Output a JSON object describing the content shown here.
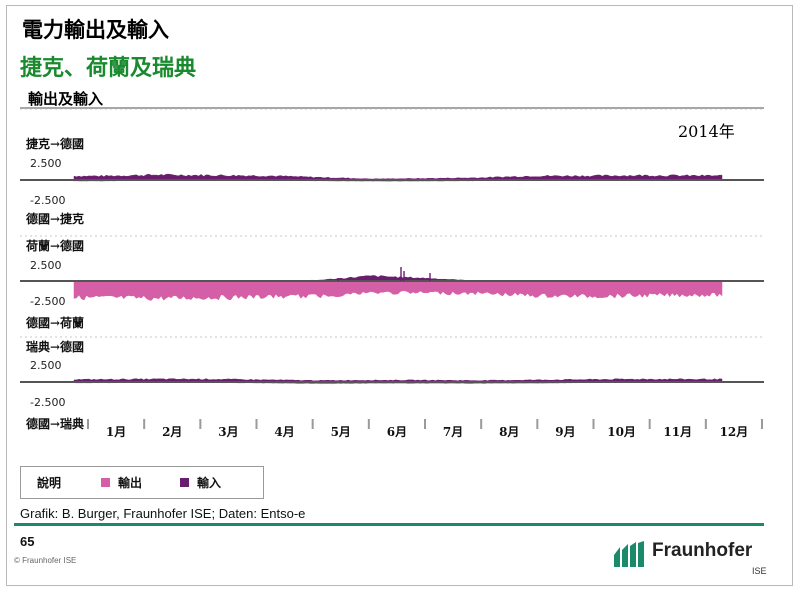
{
  "header": {
    "title": "電力輸出及輸入",
    "subtitle": "捷克、荷蘭及瑞典"
  },
  "chart_heading": "輸出及輸入",
  "year_label": "2014年",
  "colors": {
    "export": "#d45fa6",
    "import": "#6a1d6e",
    "axis": "#555555",
    "subtitle": "#1a8a2e",
    "brand": "#1a8a6a"
  },
  "chart_data": {
    "type": "area",
    "title": "輸出及輸入",
    "x_unit": "2014",
    "months": [
      "1月",
      "2月",
      "3月",
      "4月",
      "5月",
      "6月",
      "7月",
      "8月",
      "9月",
      "10月",
      "11月",
      "12月"
    ],
    "ytick_labels": [
      "2.500",
      "-2.500"
    ],
    "series": [
      {
        "name": "輸出"
      },
      {
        "name": "輸入"
      }
    ],
    "panels": [
      {
        "top_label": "捷克→德國",
        "bottom_label": "德國→捷克",
        "ylim": [
          -2500,
          2500
        ],
        "monthly": [
          {
            "month": "1月",
            "import": 550,
            "export": -150
          },
          {
            "month": "2月",
            "import": 720,
            "export": -40
          },
          {
            "month": "3月",
            "import": 660,
            "export": -40
          },
          {
            "month": "4月",
            "import": 600,
            "export": -60
          },
          {
            "month": "5月",
            "import": 380,
            "export": -120
          },
          {
            "month": "6月",
            "import": 150,
            "export": -180
          },
          {
            "month": "7月",
            "import": 210,
            "export": -150
          },
          {
            "month": "8月",
            "import": 310,
            "export": -120
          },
          {
            "month": "9月",
            "import": 560,
            "export": -50
          },
          {
            "month": "10月",
            "import": 580,
            "export": -40
          },
          {
            "month": "11月",
            "import": 640,
            "export": -40
          },
          {
            "month": "12月",
            "import": 600,
            "export": -40
          }
        ]
      },
      {
        "top_label": "荷蘭→德國",
        "bottom_label": "德國→荷蘭",
        "ylim": [
          -2500,
          2500
        ],
        "monthly": [
          {
            "month": "1月",
            "import": 0,
            "export": -2400
          },
          {
            "month": "2月",
            "import": 0,
            "export": -2500
          },
          {
            "month": "3月",
            "import": 0,
            "export": -2400
          },
          {
            "month": "4月",
            "import": 0,
            "export": -2300
          },
          {
            "month": "5月",
            "import": 100,
            "export": -2200
          },
          {
            "month": "6月",
            "import": 700,
            "export": -1700
          },
          {
            "month": "7月",
            "import": 400,
            "export": -1700
          },
          {
            "month": "8月",
            "import": 0,
            "export": -1800
          },
          {
            "month": "9月",
            "import": 0,
            "export": -2100
          },
          {
            "month": "10月",
            "import": 0,
            "export": -2200
          },
          {
            "month": "11月",
            "import": 0,
            "export": -2100
          },
          {
            "month": "12月",
            "import": 0,
            "export": -2000
          }
        ]
      },
      {
        "top_label": "瑞典→德國",
        "bottom_label": "德國→瑞典",
        "ylim": [
          -2500,
          2500
        ],
        "monthly": [
          {
            "month": "1月",
            "import": 350,
            "export": -120
          },
          {
            "month": "2月",
            "import": 400,
            "export": -80
          },
          {
            "month": "3月",
            "import": 400,
            "export": -90
          },
          {
            "month": "4月",
            "import": 300,
            "export": -150
          },
          {
            "month": "5月",
            "import": 200,
            "export": -250
          },
          {
            "month": "6月",
            "import": 250,
            "export": -200
          },
          {
            "month": "7月",
            "import": 250,
            "export": -200
          },
          {
            "month": "8月",
            "import": 200,
            "export": -220
          },
          {
            "month": "9月",
            "import": 280,
            "export": -180
          },
          {
            "month": "10月",
            "import": 340,
            "export": -110
          },
          {
            "month": "11月",
            "import": 400,
            "export": -90
          },
          {
            "month": "12月",
            "import": 380,
            "export": -60
          }
        ]
      }
    ],
    "legend": {
      "title": "說明",
      "placement": "bottom-left"
    },
    "grid": false
  },
  "source": "Grafik: B. Burger, Fraunhofer ISE; Daten: Entso-e",
  "page_number": "65",
  "copyright": "© Fraunhofer ISE",
  "brand": {
    "name": "Fraunhofer",
    "unit": "ISE"
  }
}
